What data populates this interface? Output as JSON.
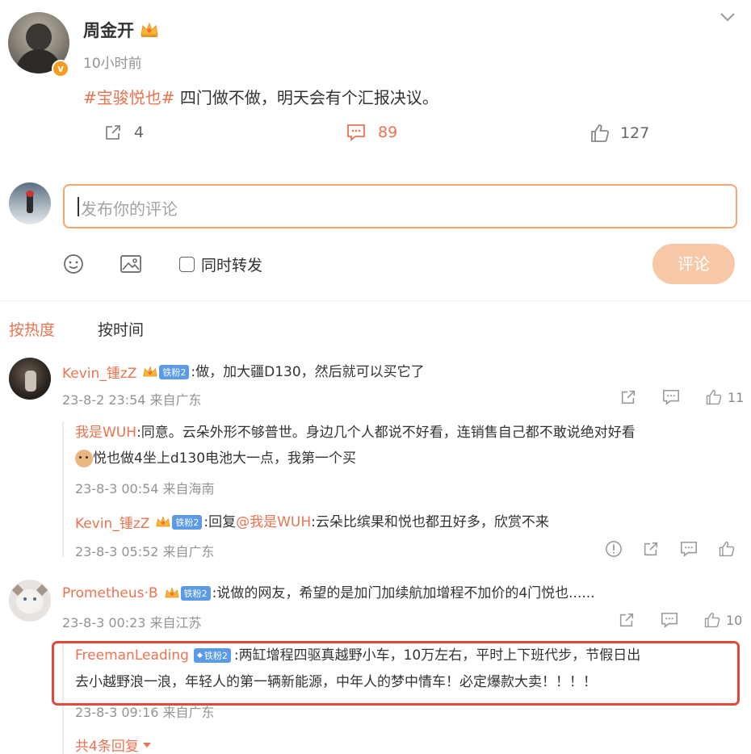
{
  "post": {
    "author": "周金开",
    "time": "10小时前",
    "hashtag": "#宝骏悦也#",
    "text": " 四门做不做，明天会有个汇报决议。",
    "repost_count": "4",
    "comment_count": "89",
    "like_count": "127"
  },
  "composer": {
    "placeholder": "发布你的评论",
    "sync_repost_label": "同时转发",
    "submit_label": "评论"
  },
  "sort_tabs": {
    "hot": "按热度",
    "time": "按时间"
  },
  "comments": [
    {
      "user": "Kevin_锺zZ",
      "badge": "铁粉2",
      "text": ":做，加大疆D130，然后就可以买它了",
      "time": "23-8-2 23:54 来自广东",
      "likes": "11",
      "replies": [
        {
          "user": "我是WUH",
          "text_line1": ":同意。云朵外形不够普世。身边几个人都说不好看，连销售自己都不敢说绝对好看",
          "text_line2": "悦也做4坐上d130电池大一点，我第一个买",
          "time": "23-8-3 00:54 来自海南"
        },
        {
          "user": "Kevin_锺zZ",
          "badge": "铁粉2",
          "reply_prefix": ":回复",
          "mention": "@我是WUH",
          "text": ":云朵比缤果和悦也都丑好多，欣赏不来",
          "time": "23-8-3 05:52 来自广东"
        }
      ]
    },
    {
      "user": "Prometheus·B",
      "badge": "铁粉2",
      "text": ":说做的网友，希望的是加门加续航加增程不加价的4门悦也......",
      "time": "23-8-3 00:23 来自江苏",
      "likes": "10",
      "replies": [
        {
          "user": "FreemanLeading",
          "badge": "铁粉2",
          "text_line1": ":两缸增程四驱真越野小车，10万左右，平时上下班代步，节假日出",
          "text_line2": "去小越野浪一浪，年轻人的第一辆新能源，中年人的梦中情车！必定爆款大卖！！！！",
          "time": "23-8-3 09:16 来自广东"
        }
      ],
      "more_replies": "共4条回复"
    }
  ],
  "colors": {
    "accent": "#eb7350",
    "highlight_box": "#e2493b",
    "submit_bg": "#f7c8a8"
  }
}
